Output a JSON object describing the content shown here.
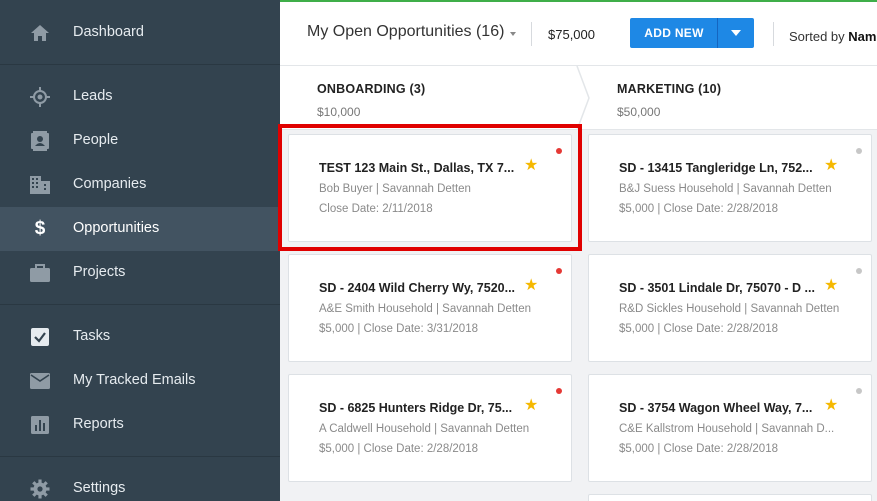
{
  "sidebar": {
    "items": [
      {
        "label": "Dashboard",
        "icon": "home-icon"
      },
      {
        "label": "Leads",
        "icon": "crosshair-icon"
      },
      {
        "label": "People",
        "icon": "contact-card-icon"
      },
      {
        "label": "Companies",
        "icon": "building-icon"
      },
      {
        "label": "Opportunities",
        "icon": "dollar-icon",
        "active": true
      },
      {
        "label": "Projects",
        "icon": "briefcase-icon"
      },
      {
        "label": "Tasks",
        "icon": "checkbox-icon"
      },
      {
        "label": "My Tracked Emails",
        "icon": "envelope-icon"
      },
      {
        "label": "Reports",
        "icon": "bar-chart-icon"
      },
      {
        "label": "Settings",
        "icon": "gear-icon"
      }
    ]
  },
  "header": {
    "view_title": "My Open Opportunities (16)",
    "total": "$75,000",
    "add_label": "ADD NEW",
    "sorted_prefix": "Sorted by ",
    "sorted_value": "Name"
  },
  "stages": [
    {
      "name": "ONBOARDING (3)",
      "amount": "$10,000"
    },
    {
      "name": "MARKETING (10)",
      "amount": "$50,000"
    }
  ],
  "columns": [
    [
      {
        "title": "TEST 123 Main St., Dallas, TX 7...",
        "line1": "Bob Buyer | Savannah Detten",
        "line2": "Close Date: 2/11/2018",
        "dot": "#e53935"
      },
      {
        "title": "SD - 2404 Wild Cherry Wy, 7520...",
        "line1": "A&E Smith Household | Savannah Detten",
        "line2": "$5,000 | Close Date: 3/31/2018",
        "dot": "#e53935"
      },
      {
        "title": "SD - 6825 Hunters Ridge Dr, 75...",
        "line1": "A Caldwell Household | Savannah Detten",
        "line2": "$5,000 | Close Date: 2/28/2018",
        "dot": "#e53935"
      }
    ],
    [
      {
        "title": "SD - 13415 Tangleridge Ln, 752...",
        "line1": "B&J Suess Household | Savannah Detten",
        "line2": "$5,000 | Close Date: 2/28/2018",
        "dot": "#c7c7c7"
      },
      {
        "title": "SD - 3501 Lindale Dr, 75070 - D ...",
        "line1": "R&D Sickles Household | Savannah Detten",
        "line2": "$5,000 | Close Date: 2/28/2018",
        "dot": "#c7c7c7"
      },
      {
        "title": "SD - 3754 Wagon Wheel Way, 7...",
        "line1": "C&E Kallstrom Household | Savannah D...",
        "line2": "$5,000 | Close Date: 2/28/2018",
        "dot": "#c7c7c7"
      }
    ]
  ],
  "colors": {
    "accent": "#1e88e5",
    "sidebar": "#33434f",
    "active": "#425361",
    "highlight": "#e00000",
    "star": "#f5b800"
  }
}
